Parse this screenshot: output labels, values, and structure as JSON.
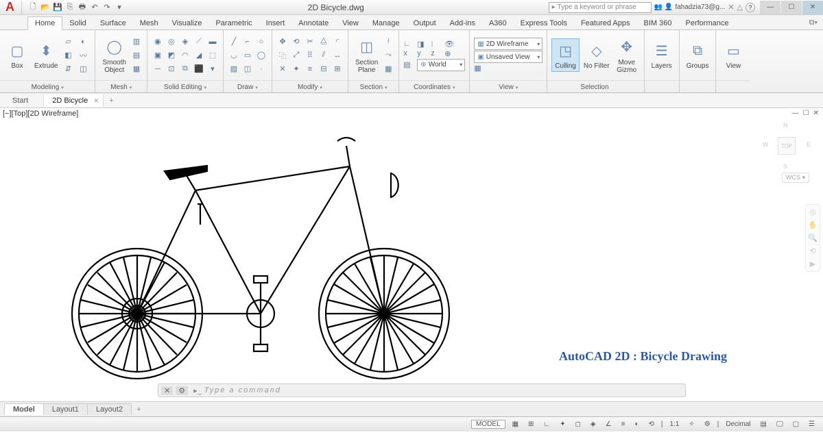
{
  "app": {
    "logo": "A",
    "title": "2D Bicycle.dwg"
  },
  "qat": [
    "⎘",
    "🖶",
    "⎌",
    "↻",
    "⌂",
    "☰",
    "▦",
    "▾"
  ],
  "search": {
    "placeholder": "Type a keyword or phrase"
  },
  "user": {
    "name": "fahadzia73@g...",
    "help": "?"
  },
  "ribbon_tabs": [
    "Home",
    "Solid",
    "Surface",
    "Mesh",
    "Visualize",
    "Parametric",
    "Insert",
    "Annotate",
    "View",
    "Manage",
    "Output",
    "Add-ins",
    "A360",
    "Express Tools",
    "Featured Apps",
    "BIM 360",
    "Performance"
  ],
  "active_tab": "Home",
  "panels": {
    "modeling": {
      "label": "Modeling",
      "box": "Box",
      "extrude": "Extrude"
    },
    "mesh": {
      "label": "Mesh",
      "smooth": "Smooth\nObject"
    },
    "solid_editing": {
      "label": "Solid Editing"
    },
    "draw": {
      "label": "Draw"
    },
    "modify": {
      "label": "Modify"
    },
    "section": {
      "label": "Section",
      "plane": "Section\nPlane"
    },
    "coords": {
      "label": "Coordinates",
      "world": "World"
    },
    "view": {
      "label": "View",
      "wire": "2D Wireframe",
      "unsaved": "Unsaved View"
    },
    "selection": {
      "label": "Selection",
      "culling": "Culling",
      "nofilter": "No Filter",
      "gizmo": "Move\nGizmo"
    },
    "layers": "Layers",
    "groups": "Groups",
    "viewp": "View"
  },
  "file_tabs": [
    {
      "label": "Start"
    },
    {
      "label": "2D Bicycle",
      "active": true
    }
  ],
  "viewport": {
    "label": "[−][Top][2D Wireframe]",
    "cube_top": "TOP",
    "n": "N",
    "s": "S",
    "e": "E",
    "w": "W",
    "wcs": "WCS ▾"
  },
  "drawing_title": "AutoCAD 2D : Bicycle Drawing",
  "cmdline": {
    "prompt": "Type a command"
  },
  "layout_tabs": [
    "Model",
    "Layout1",
    "Layout2"
  ],
  "status": {
    "model": "MODEL",
    "scale": "1:1",
    "units": "Decimal"
  }
}
